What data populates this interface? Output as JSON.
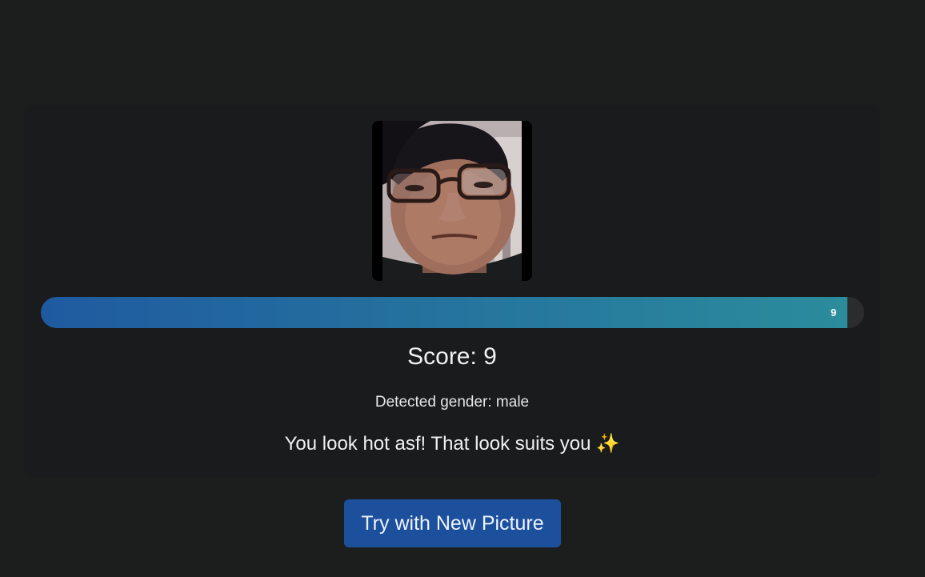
{
  "result": {
    "photo_alt": "uploaded face photo",
    "score_bar": {
      "value_label": "9",
      "fraction": 0.98,
      "gradient_start": "#1f5aa0",
      "gradient_end": "#2b8c9c",
      "track_color": "#2a2c2d"
    },
    "score_text": "Score: 9",
    "gender_text": "Detected gender: male",
    "message_text": "You look hot asf! That look suits you",
    "message_emoji": "✨"
  },
  "actions": {
    "retry_label": "Try with New Picture",
    "retry_color": "#1c4f9c"
  },
  "theme": {
    "background": "#1c1d1d",
    "card_background": "#1a1b1c"
  }
}
